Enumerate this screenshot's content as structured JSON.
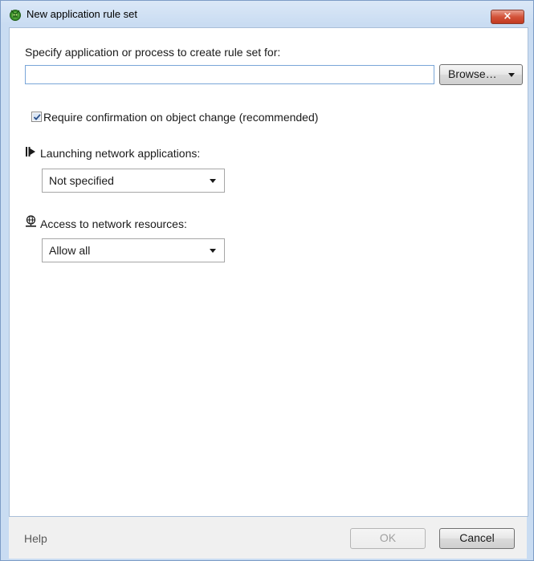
{
  "window": {
    "title": "New application rule set",
    "close_glyph": "×"
  },
  "form": {
    "specify_label": "Specify application or process to create rule set for:",
    "path_value": "",
    "browse_label": "Browse…",
    "confirm_checkbox": {
      "label": "Require confirmation on object change (recommended)",
      "checked": true
    },
    "launching": {
      "label": "Launching network applications:",
      "selected": "Not specified",
      "icon": "network-launch-icon"
    },
    "access": {
      "label": "Access to network resources:",
      "selected": "Allow all",
      "icon": "globe-icon"
    }
  },
  "footer": {
    "help_label": "Help",
    "ok_label": "OK",
    "cancel_label": "Cancel"
  },
  "colors": {
    "title_bar": "#c9dcf2",
    "close_button": "#c23a20",
    "input_border": "#7aa6d8",
    "footer_bg": "#f0f0f0"
  }
}
